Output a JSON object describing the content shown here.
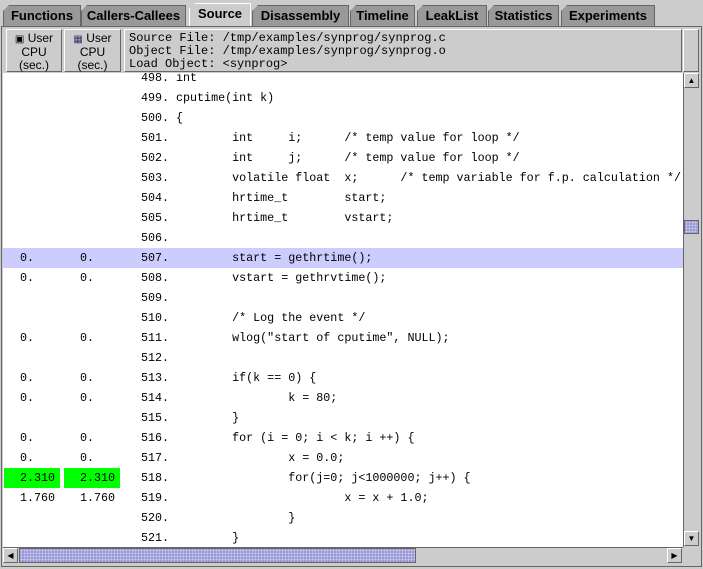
{
  "tabs": [
    {
      "label": "Functions",
      "selected": false
    },
    {
      "label": "Callers-Callees",
      "selected": false
    },
    {
      "label": "Source",
      "selected": true
    },
    {
      "label": "Disassembly",
      "selected": false
    },
    {
      "label": "Timeline",
      "selected": false
    },
    {
      "label": "LeakList",
      "selected": false
    },
    {
      "label": "Statistics",
      "selected": false
    },
    {
      "label": "Experiments",
      "selected": false
    }
  ],
  "columns": [
    {
      "label1": "User",
      "label2": "CPU",
      "label3": "(sec.)",
      "icon": "exclusive-metric-icon"
    },
    {
      "label1": "User",
      "label2": "CPU",
      "label3": "(sec.)",
      "icon": "inclusive-metric-icon"
    }
  ],
  "source_header": {
    "source_file": "Source File: /tmp/examples/synprog/synprog.c",
    "object_file": "Object File: /tmp/examples/synprog/synprog.o",
    "load_object": "Load Object: <synprog>"
  },
  "colors": {
    "hot": "#00ff00",
    "selected_row": "#ccccff"
  },
  "rows": [
    {
      "excl": "",
      "incl": "",
      "line": "498.",
      "code": "int"
    },
    {
      "excl": "",
      "incl": "",
      "line": "499.",
      "code": "cputime(int k)"
    },
    {
      "excl": "",
      "incl": "",
      "line": "500.",
      "code": "{"
    },
    {
      "excl": "",
      "incl": "",
      "line": "501.",
      "code": "        int     i;      /* temp value for loop */"
    },
    {
      "excl": "",
      "incl": "",
      "line": "502.",
      "code": "        int     j;      /* temp value for loop */"
    },
    {
      "excl": "",
      "incl": "",
      "line": "503.",
      "code": "        volatile float  x;      /* temp variable for f.p. calculation */"
    },
    {
      "excl": "",
      "incl": "",
      "line": "504.",
      "code": "        hrtime_t        start;"
    },
    {
      "excl": "",
      "incl": "",
      "line": "505.",
      "code": "        hrtime_t        vstart;"
    },
    {
      "excl": "",
      "incl": "",
      "line": "506.",
      "code": ""
    },
    {
      "excl": "0.",
      "incl": "0.",
      "line": "507.",
      "code": "        start = gethrtime();",
      "selected": true
    },
    {
      "excl": "0.",
      "incl": "0.",
      "line": "508.",
      "code": "        vstart = gethrvtime();"
    },
    {
      "excl": "",
      "incl": "",
      "line": "509.",
      "code": ""
    },
    {
      "excl": "",
      "incl": "",
      "line": "510.",
      "code": "        /* Log the event */"
    },
    {
      "excl": "0.",
      "incl": "0.",
      "line": "511.",
      "code": "        wlog(\"start of cputime\", NULL);"
    },
    {
      "excl": "",
      "incl": "",
      "line": "512.",
      "code": ""
    },
    {
      "excl": "0.",
      "incl": "0.",
      "line": "513.",
      "code": "        if(k == 0) {"
    },
    {
      "excl": "0.",
      "incl": "0.",
      "line": "514.",
      "code": "                k = 80;"
    },
    {
      "excl": "",
      "incl": "",
      "line": "515.",
      "code": "        }"
    },
    {
      "excl": "0.",
      "incl": "0.",
      "line": "516.",
      "code": "        for (i = 0; i < k; i ++) {"
    },
    {
      "excl": "0.",
      "incl": "0.",
      "line": "517.",
      "code": "                x = 0.0;"
    },
    {
      "excl": "2.310",
      "incl": "2.310",
      "line": "518.",
      "code": "                for(j=0; j<1000000; j++) {",
      "hot": true
    },
    {
      "excl": "1.760",
      "incl": "1.760",
      "line": "519.",
      "code": "                        x = x + 1.0;"
    },
    {
      "excl": "",
      "incl": "",
      "line": "520.",
      "code": "                }"
    },
    {
      "excl": "",
      "incl": "",
      "line": "521.",
      "code": "        }"
    }
  ]
}
